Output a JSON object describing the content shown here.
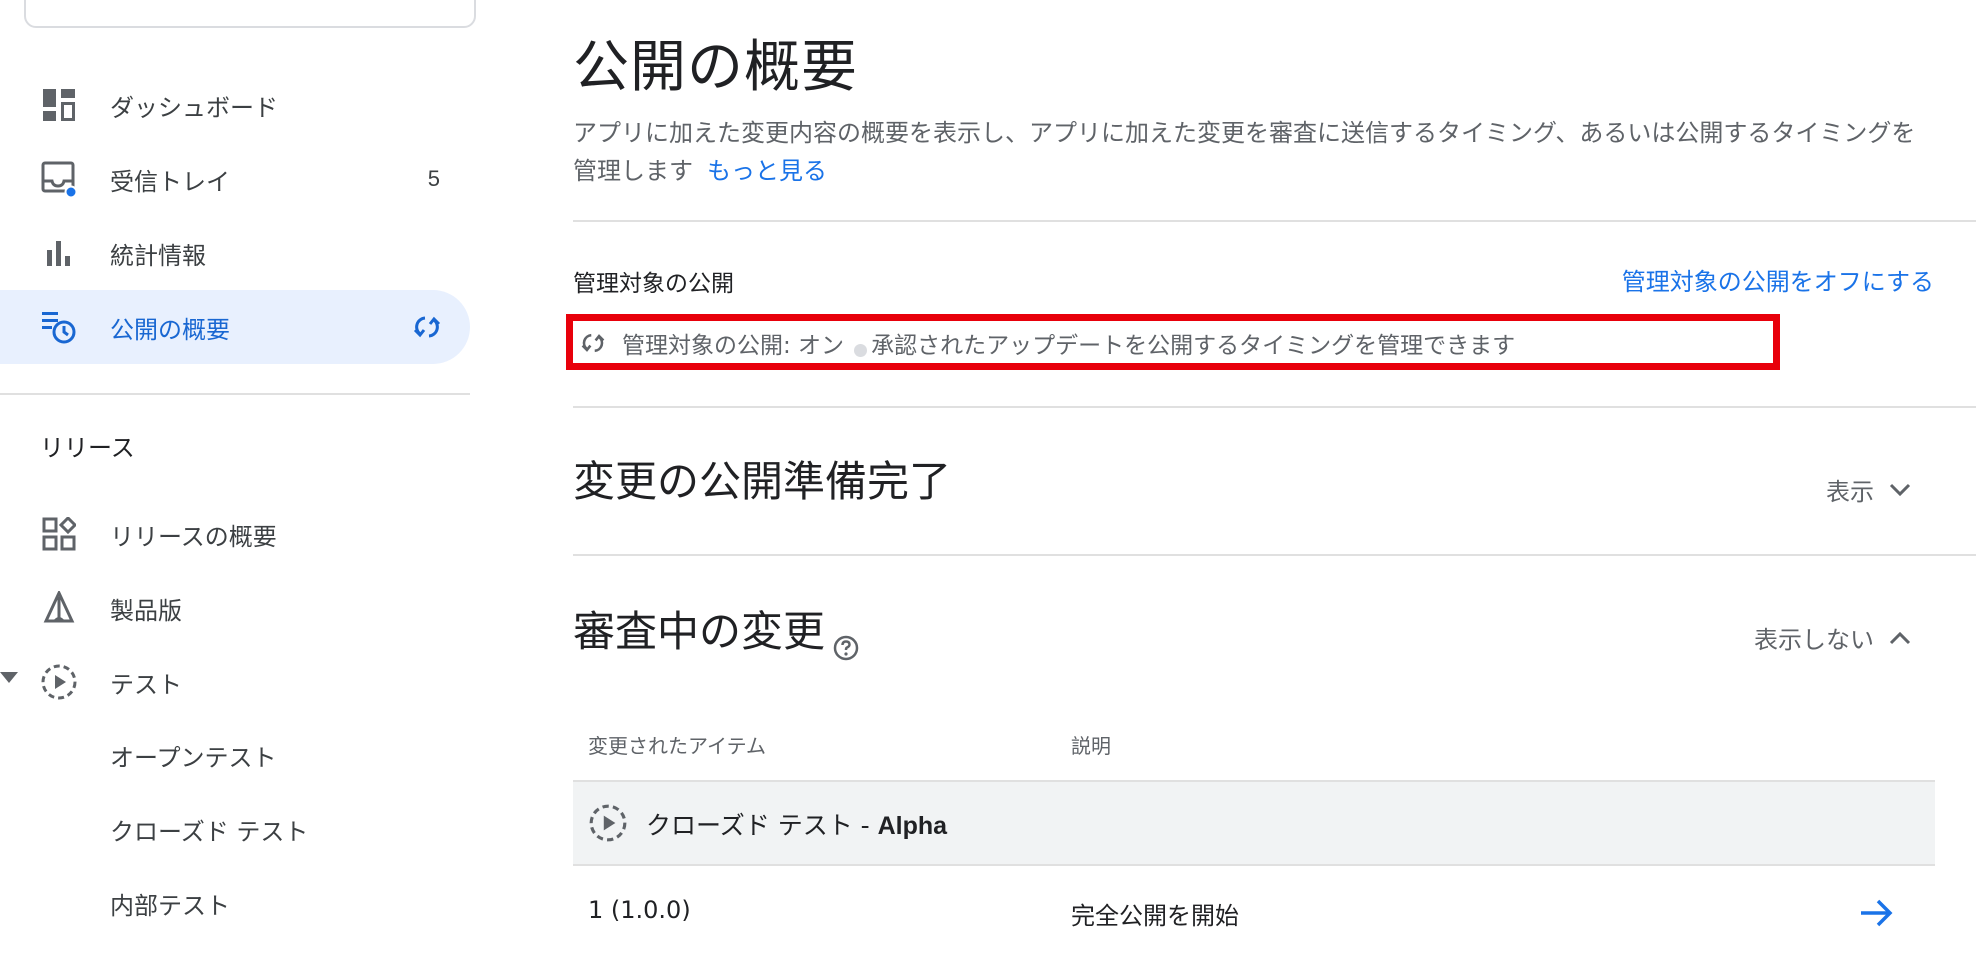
{
  "sidebar": {
    "items": [
      {
        "label": "ダッシュボード",
        "icon": "dashboard-icon"
      },
      {
        "label": "受信トレイ",
        "icon": "inbox-icon",
        "badge": "5"
      },
      {
        "label": "統計情報",
        "icon": "bar-chart-icon"
      },
      {
        "label": "公開の概要",
        "icon": "publishing-overview-icon",
        "active": true
      }
    ],
    "release_section": "リリース",
    "release_items": [
      {
        "label": "リリースの概要",
        "icon": "releases-overview-icon"
      },
      {
        "label": "製品版",
        "icon": "production-icon"
      },
      {
        "label": "テスト",
        "icon": "testing-icon"
      }
    ],
    "testing_sub_items": [
      "オープンテスト",
      "クローズド テスト",
      "内部テスト"
    ]
  },
  "main": {
    "title": "公開の概要",
    "description": "アプリに加えた変更内容の概要を表示し、アプリに加えた変更を審査に送信するタイミング、あるいは公開するタイミングを管理します",
    "learn_more": "もっと見る",
    "managed_publishing": {
      "label": "管理対象の公開",
      "turn_off_link": "管理対象の公開をオフにする",
      "status": "管理対象の公開: オン",
      "status_description": "承認されたアップデートを公開するタイミングを管理できます"
    },
    "ready_section": {
      "title": "変更の公開準備完了",
      "toggle": "表示"
    },
    "review_section": {
      "title": "審査中の変更",
      "toggle": "表示しない",
      "columns": [
        "変更されたアイテム",
        "説明"
      ],
      "group": {
        "label": "クローズド テスト - ",
        "label_bold": "Alpha"
      },
      "rows": [
        {
          "item": "1 (1.0.0)",
          "description": "完全公開を開始"
        }
      ]
    }
  },
  "colors": {
    "accent": "#1a73e8",
    "active_bg": "#e8f0fe",
    "highlight": "#e8000b"
  }
}
